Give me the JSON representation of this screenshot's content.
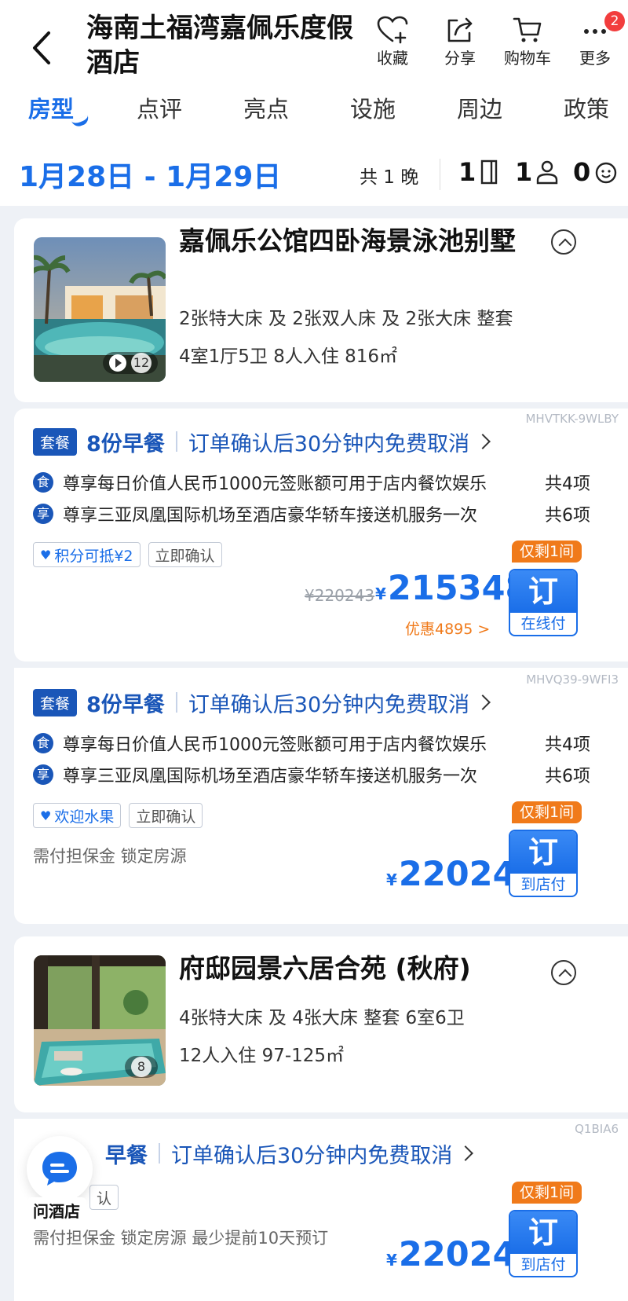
{
  "header": {
    "title": "海南土福湾嘉佩乐度假酒店",
    "actions": [
      {
        "icon": "heart-plus-icon",
        "label": "收藏"
      },
      {
        "icon": "share-icon",
        "label": "分享"
      },
      {
        "icon": "cart-icon",
        "label": "购物车"
      },
      {
        "icon": "more-icon",
        "label": "更多",
        "badge": "2"
      }
    ]
  },
  "tabs": [
    {
      "label": "房型",
      "active": true
    },
    {
      "label": "点评"
    },
    {
      "label": "亮点"
    },
    {
      "label": "设施"
    },
    {
      "label": "周边"
    },
    {
      "label": "政策"
    }
  ],
  "stay": {
    "date_range": "1月28日 - 1月29日",
    "nights": "共 1 晚",
    "rooms": "1",
    "adults": "1",
    "children": "0"
  },
  "rooms": [
    {
      "name": "嘉佩乐公馆四卧海景泳池别墅",
      "beds": "2张特大床 及 2张双人床 及 2张大床  整套",
      "layout": "4室1厅5卫  8人入住  816㎡",
      "photo_count": "12",
      "has_video": true,
      "offers": [
        {
          "code": "MHVTKK-9WLBY",
          "tag": "套餐",
          "meal": "8份早餐",
          "cancel": "订单确认后30分钟内免费取消",
          "benefits": [
            {
              "icon": "食",
              "text": "尊享每日价值人民币1000元签账额可用于店内餐饮娱乐",
              "count": "共4项"
            },
            {
              "icon": "享",
              "text": "尊享三亚凤凰国际机场至酒店豪华轿车接送机服务一次",
              "count": "共6项"
            }
          ],
          "tags": [
            "积分可抵¥2",
            "立即确认"
          ],
          "original_price": "¥220243",
          "currency": "¥",
          "price": "215348",
          "discount": "优惠4895 >",
          "remain": "仅剩1间",
          "book": "订",
          "pay": "在线付"
        },
        {
          "code": "MHVQ39-9WFI3",
          "tag": "套餐",
          "meal": "8份早餐",
          "cancel": "订单确认后30分钟内免费取消",
          "benefits": [
            {
              "icon": "食",
              "text": "尊享每日价值人民币1000元签账额可用于店内餐饮娱乐",
              "count": "共4项"
            },
            {
              "icon": "享",
              "text": "尊享三亚凤凰国际机场至酒店豪华轿车接送机服务一次",
              "count": "共6项"
            }
          ],
          "tags": [
            "欢迎水果",
            "立即确认"
          ],
          "note": "需付担保金  锁定房源",
          "currency": "¥",
          "price": "220243",
          "remain": "仅剩1间",
          "book": "订",
          "pay": "到店付"
        }
      ]
    },
    {
      "name": "府邸园景六居合苑 (秋府)",
      "beds": "4张特大床 及 4张大床  整套  6室6卫",
      "layout": "12人入住  97-125㎡",
      "photo_count": "8",
      "offers": [
        {
          "code": "Q1BIA6",
          "meal": "早餐",
          "cancel": "订单确认后30分钟内免费取消",
          "tags": [
            "认"
          ],
          "note": "需付担保金  锁定房源  最少提前10天预订",
          "currency": "¥",
          "price": "220243",
          "remain": "仅剩1间",
          "book": "订",
          "pay": "到店付"
        }
      ]
    }
  ],
  "chat": {
    "label": "问酒店",
    "icon": "chat-bubble-icon"
  },
  "colors": {
    "accent": "#1a6ee8",
    "navy": "#1a56b8",
    "orange": "#f07a1a"
  }
}
